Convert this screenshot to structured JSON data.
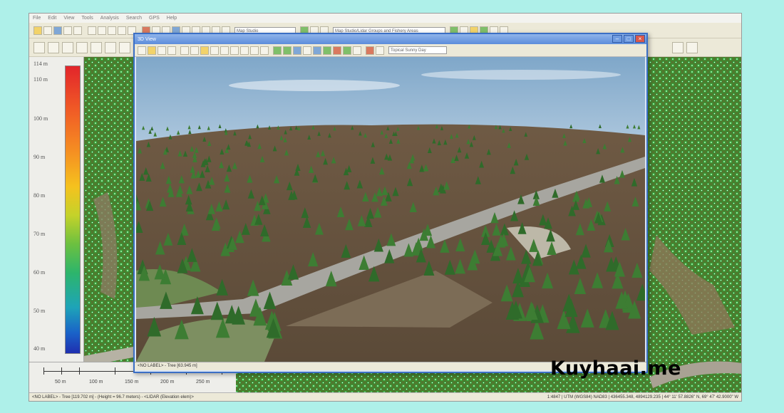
{
  "menu": [
    "File",
    "Edit",
    "View",
    "Tools",
    "Analysis",
    "Search",
    "GPS",
    "Help"
  ],
  "toolbar": {
    "view_select": "Map Studio",
    "layer_select": "Map Studio/Lidar Groups and Fishery Areas"
  },
  "legend": {
    "labels": [
      "114 m",
      "110 m",
      "100 m",
      "90 m",
      "80 m",
      "70 m",
      "60 m",
      "50 m",
      "40 m"
    ]
  },
  "scale": {
    "labels": [
      "50 m",
      "100 m",
      "150 m",
      "200 m",
      "250 m"
    ]
  },
  "window3d": {
    "title": "3D View",
    "dropdown": "Topical Sunny Day",
    "status": "<NO LABEL> - Tree [63.945 m]"
  },
  "status": {
    "left": "<NO LABEL> - Tree [119.702 m] - (Height = 96.7 meters) - <LIDAR (Elevation elem)>",
    "right": "1:4847 | UTM (WGS84) NAD83 | 436455.348, 4894129.235 | 44° 11' 57.8826\" N, 69° 47' 42.9000\" W"
  },
  "watermark": "Kuyhaai.me",
  "colors": {
    "background": "#aef0e9",
    "window_border": "#3b6fc5",
    "legend_high": "#e2252b",
    "legend_low": "#1f2fb0"
  }
}
